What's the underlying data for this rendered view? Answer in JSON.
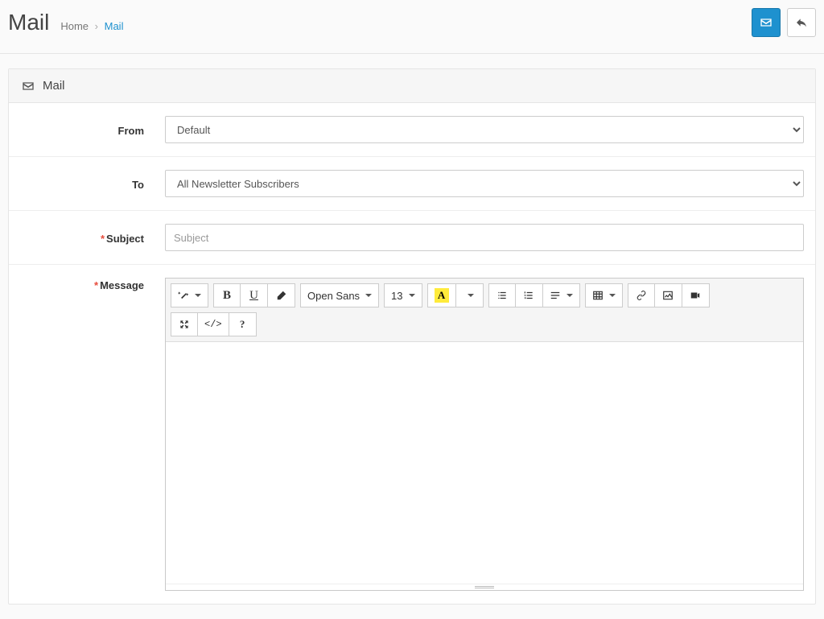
{
  "header": {
    "title": "Mail",
    "breadcrumb": {
      "home": "Home",
      "current": "Mail"
    }
  },
  "panel": {
    "title": "Mail"
  },
  "form": {
    "from_label": "From",
    "from_value": "Default",
    "to_label": "To",
    "to_value": "All Newsletter Subscribers",
    "subject_label": "Subject",
    "subject_placeholder": "Subject",
    "message_label": "Message"
  },
  "editor": {
    "font_family": "Open Sans",
    "font_size": "13"
  }
}
